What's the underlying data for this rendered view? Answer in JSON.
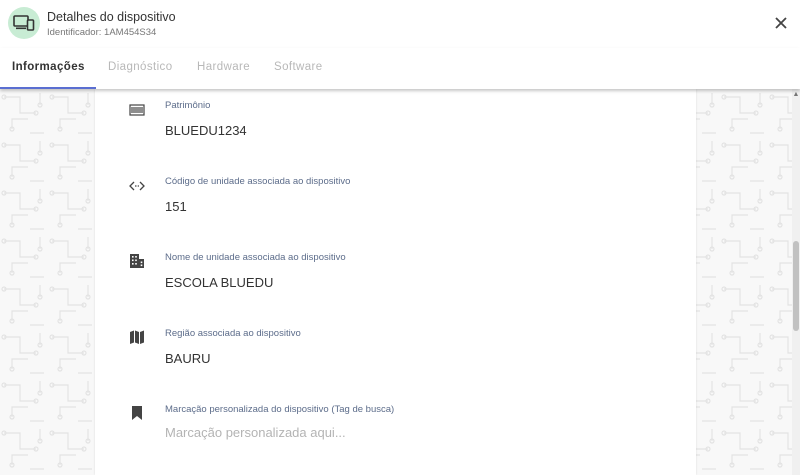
{
  "header": {
    "title": "Detalhes do dispositivo",
    "identifier": "Identificador: 1AM454S34"
  },
  "tabs": [
    {
      "label": "Informações",
      "active": true
    },
    {
      "label": "Diagnóstico",
      "active": false
    },
    {
      "label": "Hardware",
      "active": false
    },
    {
      "label": "Software",
      "active": false
    }
  ],
  "fields": {
    "patrimonio": {
      "label": "Patrimônio",
      "value": "BLUEDU1234",
      "icon": "barcode-icon"
    },
    "codigo_unidade": {
      "label": "Código de unidade associada ao dispositivo",
      "value": "151",
      "icon": "code-arrows-icon"
    },
    "nome_unidade": {
      "label": "Nome de unidade associada ao dispositivo",
      "value": "ESCOLA BLUEDU",
      "icon": "building-icon"
    },
    "regiao": {
      "label": "Região associada ao dispositivo",
      "value": "BAURU",
      "icon": "map-icon"
    },
    "marcacao": {
      "label": "Marcação personalizada do dispositivo (Tag de busca)",
      "value": "",
      "placeholder": "Marcação personalizada aqui...",
      "icon": "bookmark-icon"
    }
  },
  "colors": {
    "accent": "#5a6ed1",
    "avatar_bg": "#c8ecd4",
    "label": "#5c6c8a"
  }
}
